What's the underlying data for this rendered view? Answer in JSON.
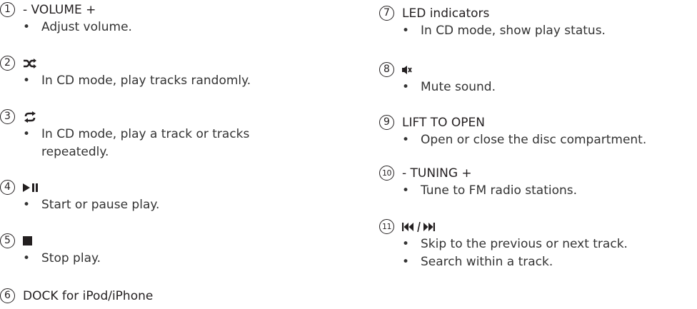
{
  "left": [
    {
      "num": "1",
      "label": "- VOLUME +",
      "icon": "",
      "bullets": [
        [
          "Adjust volume."
        ]
      ]
    },
    {
      "num": "2",
      "label": "",
      "icon": "shuffle-icon",
      "bullets": [
        [
          "In CD mode, play tracks randomly."
        ]
      ]
    },
    {
      "num": "3",
      "label": "",
      "icon": "repeat-icon",
      "bullets": [
        [
          "In CD mode, play a track or tracks",
          "repeatedly."
        ]
      ]
    },
    {
      "num": "4",
      "label": "",
      "icon": "play-pause-icon",
      "bullets": [
        [
          "Start or pause play."
        ]
      ]
    },
    {
      "num": "5",
      "label": "",
      "icon": "stop-icon",
      "bullets": [
        [
          "Stop play."
        ]
      ]
    },
    {
      "num": "6",
      "label": "DOCK for iPod/iPhone",
      "icon": "",
      "bullets": []
    }
  ],
  "right": [
    {
      "num": "7",
      "label": "LED indicators",
      "icon": "",
      "bullets": [
        [
          "In CD mode, show play status."
        ]
      ]
    },
    {
      "num": "8",
      "label": "",
      "icon": "mute-icon",
      "bullets": [
        [
          "Mute sound."
        ]
      ]
    },
    {
      "num": "9",
      "label": "LIFT TO OPEN",
      "icon": "",
      "bullets": [
        [
          "Open or close the disc compartment."
        ]
      ]
    },
    {
      "num": "10",
      "label": "- TUNING +",
      "icon": "",
      "bullets": [
        [
          "Tune to FM radio stations."
        ]
      ]
    },
    {
      "num": "11",
      "label": "",
      "icon": "skip-prev-next-icon",
      "bullets": [
        [
          "Skip to the previous or next track."
        ],
        [
          "Search within a track."
        ]
      ]
    }
  ],
  "icon_color": "#231f20"
}
